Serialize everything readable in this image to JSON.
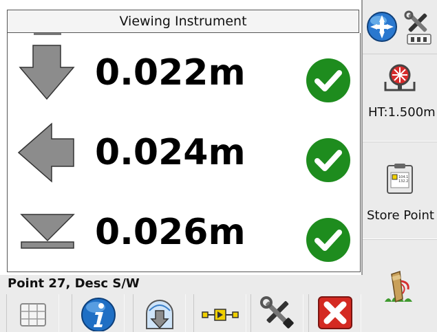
{
  "window": {
    "title": "Viewing Instrument"
  },
  "measurements": [
    {
      "direction": "down",
      "value": "0.022m",
      "status": "ok"
    },
    {
      "direction": "left",
      "value": "0.024m",
      "status": "ok"
    },
    {
      "direction": "vertical",
      "value": "0.026m",
      "status": "ok"
    }
  ],
  "status": {
    "text": "Point 27, Desc S/W"
  },
  "sidebar": {
    "height_label": "HT:1.500m",
    "store_label": "Store Point",
    "store_card_lines": [
      "104.1",
      "132.2"
    ]
  },
  "colors": {
    "check_green": "#1e8c1e",
    "arrow_gray": "#8c8c8c",
    "close_red": "#d42a22",
    "info_blue": "#1f6fc4"
  },
  "toolbar_icons": [
    "grid-icon",
    "info-icon",
    "map-stakeout-icon",
    "fence-connect-icon",
    "settings-tools-icon",
    "close-icon"
  ]
}
